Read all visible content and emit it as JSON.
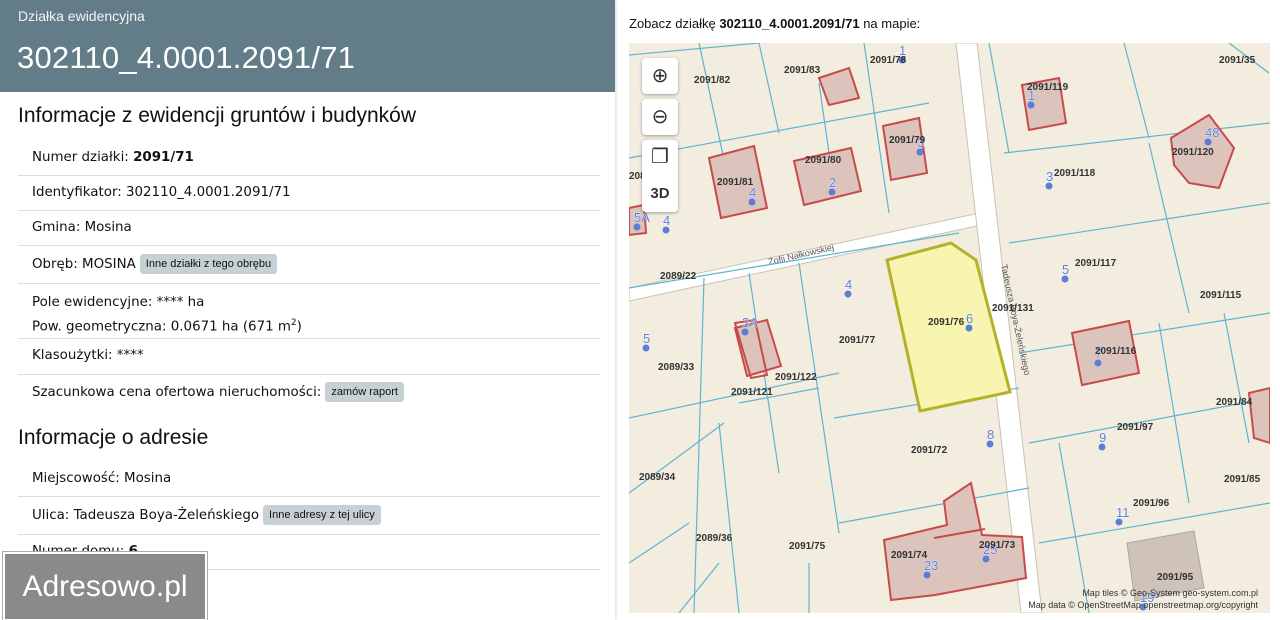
{
  "header": {
    "subtitle": "Działka ewidencyjna",
    "title": "302110_4.0001.2091/71"
  },
  "section_land": {
    "heading": "Informacje z ewidencji gruntów i budynków",
    "numer_label": "Numer działki:",
    "numer_value": "2091/71",
    "identyfikator": "Identyfikator: 302110_4.0001.2091/71",
    "gmina": "Gmina: Mosina",
    "obreb": "Obręb: MOSINA",
    "obreb_button": "Inne działki z tego obrębu",
    "pole": "Pole ewidencyjne: **** ha",
    "pow_prefix": "Pow. geometryczna: 0.0671 ha (671 m",
    "pow_sup": "2",
    "pow_suffix": ")",
    "klasouzytki": "Klasoużytki: ****",
    "cena": "Szacunkowa cena ofertowa nieruchomości:",
    "cena_button": "zamów raport"
  },
  "section_address": {
    "heading": "Informacje o adresie",
    "miejscowosc": "Miejscowość: Mosina",
    "ulica": "Ulica: Tadeusza Boya-Żeleńskiego",
    "ulica_button": "Inne adresy z tej ulicy",
    "numer_domu_label": "Numer domu:",
    "numer_domu_value": "6"
  },
  "logo": "Adresowo.pl",
  "map_caption": {
    "prefix": "Zobacz działkę ",
    "parcel": "302110_4.0001.2091/71",
    "suffix": " na mapie:"
  },
  "map_controls": {
    "zoom_in": "⊕",
    "zoom_out": "⊖",
    "layers": "❐",
    "three_d": "3D"
  },
  "map_attribution": {
    "tiles": "Map tiles © Geo-System geo-system.com.pl",
    "data": "Map data © OpenStreetMap openstreetmap.org/copyright"
  },
  "map_streets": {
    "nalkowskiej": "Zofii Nałkowskiej",
    "boya": "Tadeusza Boya-Żeleńskiego"
  },
  "map_parcels": [
    "2091/82",
    "2091/83",
    "2091/78",
    "2091/35",
    "2091/119",
    "2091/79",
    "2091/80",
    "2091/81",
    "2089/31",
    "2091/120",
    "2091/118",
    "2091/117",
    "2089/22",
    "2091/115",
    "2091/131",
    "2091/76",
    "2091/77",
    "2089/33",
    "2091/122",
    "2091/121",
    "2091/116",
    "2091/84",
    "2091/97",
    "2091/72",
    "2089/34",
    "2091/85",
    "2091/96",
    "2089/36",
    "2091/75",
    "2091/74",
    "2091/73",
    "2091/95"
  ],
  "map_house_numbers": [
    "1",
    "4",
    "2",
    "3",
    "48",
    "1",
    "5",
    "6",
    "3",
    "3A",
    "5",
    "7",
    "8",
    "9",
    "11",
    "23",
    "25",
    "19",
    "5A",
    "4",
    "4"
  ],
  "colors": {
    "header_bg": "#627d87",
    "parcel_line": "#5fb3d3",
    "building_fill": "#dcc4bd",
    "building_stroke": "#c84a4a",
    "selected_fill": "#f7f5b0",
    "selected_stroke": "#b5b22a",
    "map_bg": "#f3ede0",
    "pin": "#5b7fd8"
  }
}
